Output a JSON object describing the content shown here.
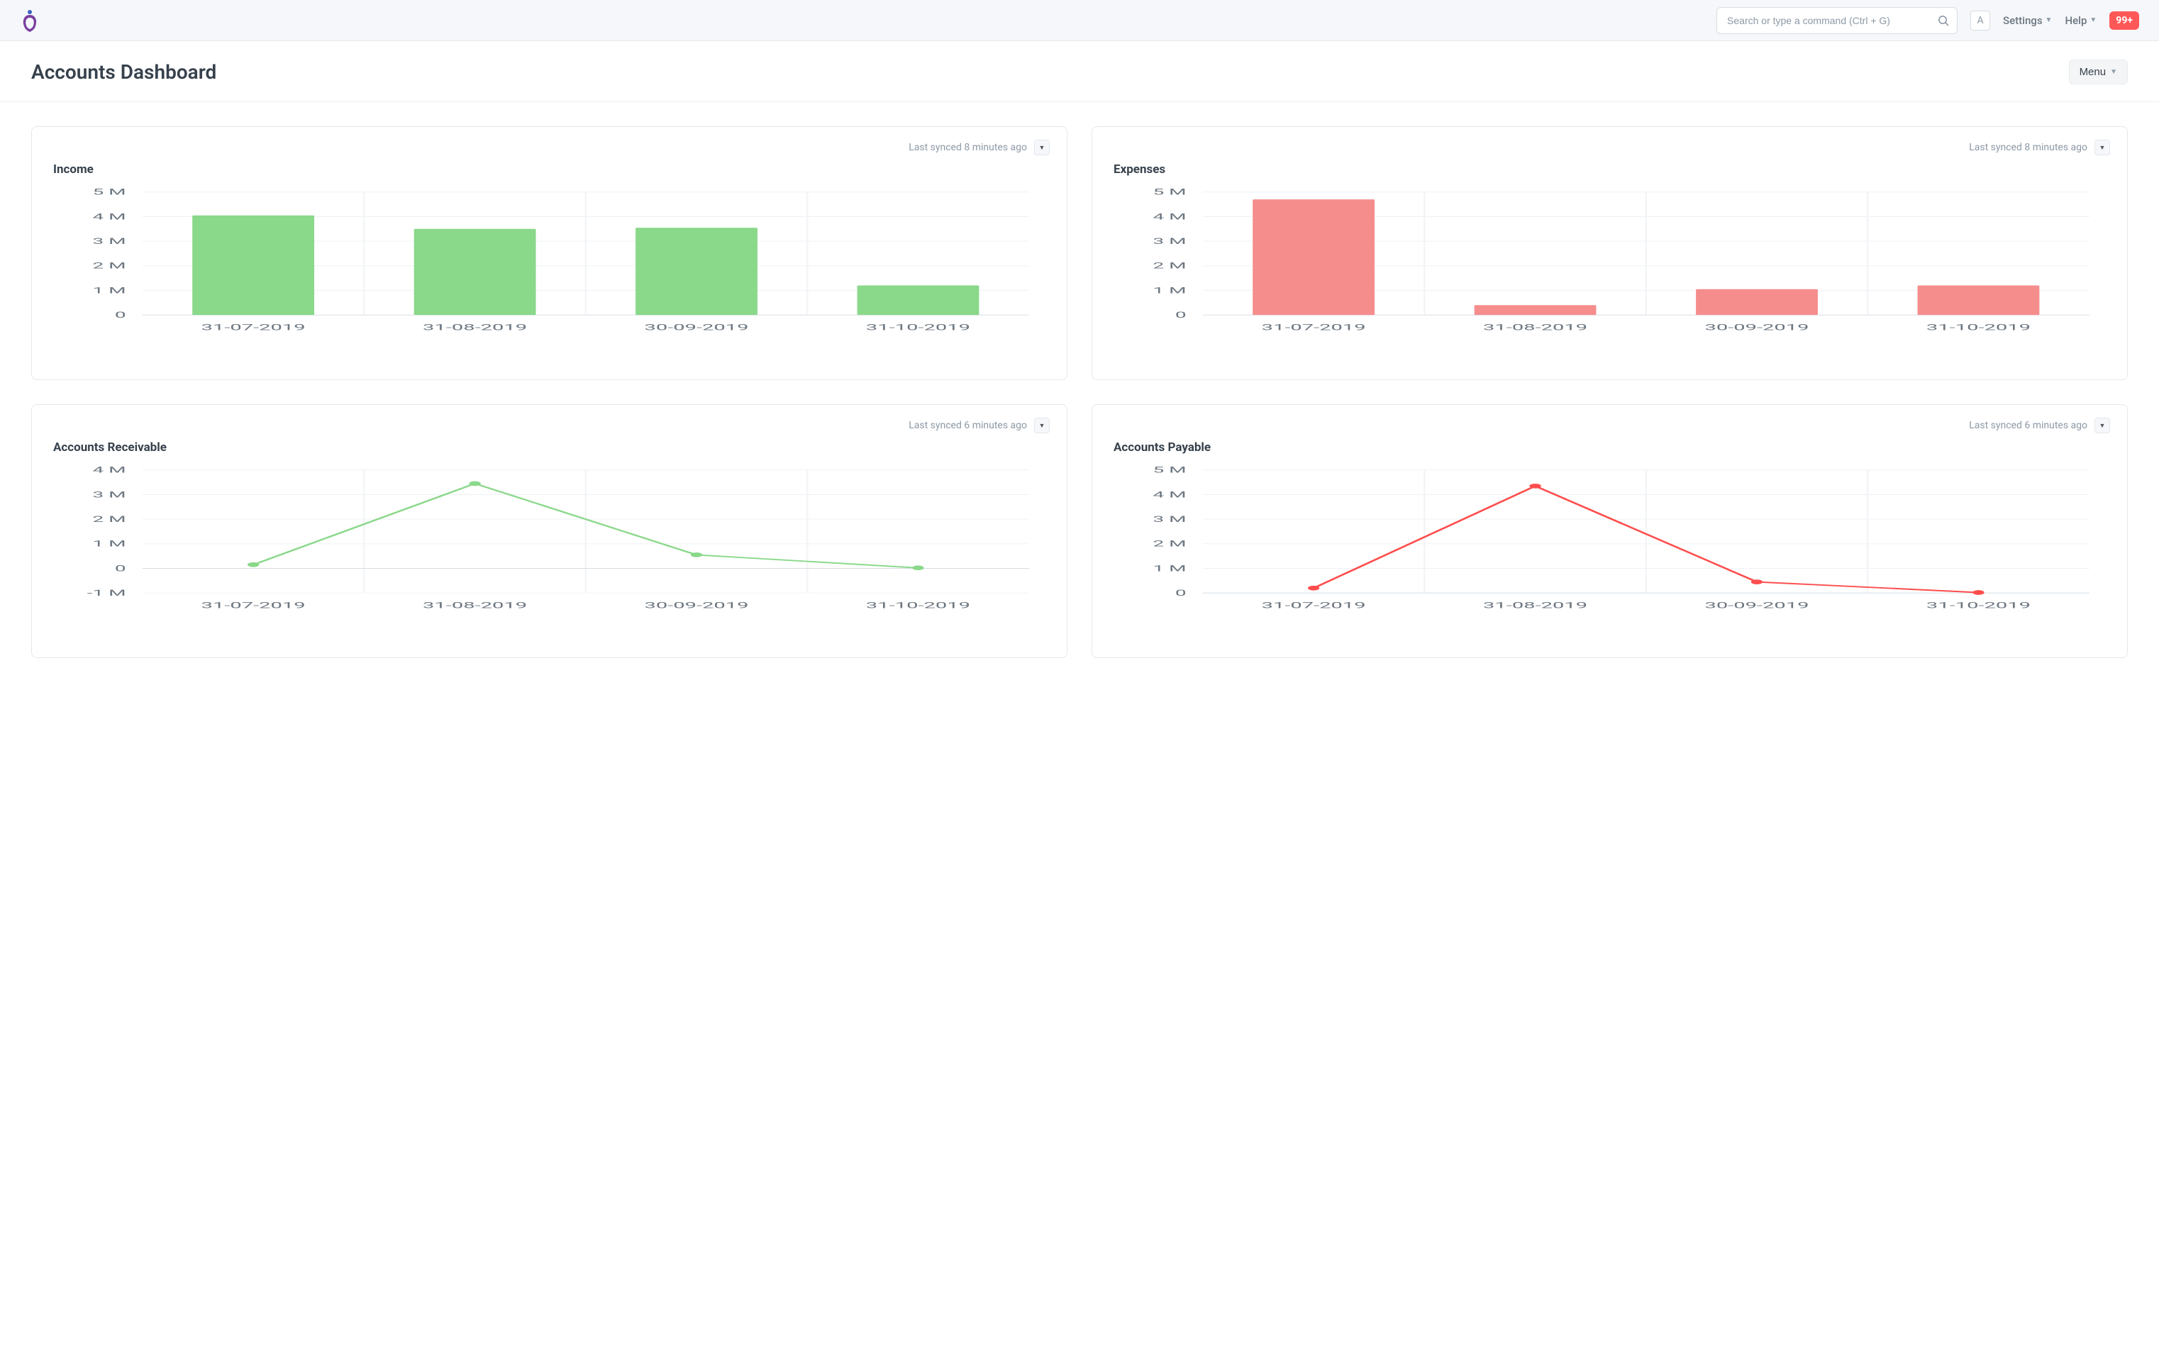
{
  "navbar": {
    "search_placeholder": "Search or type a command (Ctrl + G)",
    "avatar_letter": "A",
    "settings_label": "Settings",
    "help_label": "Help",
    "notif_badge": "99+"
  },
  "page": {
    "title": "Accounts Dashboard",
    "menu_label": "Menu"
  },
  "colors": {
    "green": "#8ad88a",
    "red": "#f58d8d",
    "red_line": "#ff4d4d",
    "grid": "#edf1f5",
    "axis": "#d7dde3",
    "text_muted": "#6c7680"
  },
  "cards": {
    "income": {
      "title": "Income",
      "synced": "Last synced 8 minutes ago"
    },
    "expenses": {
      "title": "Expenses",
      "synced": "Last synced 8 minutes ago"
    },
    "ar": {
      "title": "Accounts Receivable",
      "synced": "Last synced 6 minutes ago"
    },
    "ap": {
      "title": "Accounts Payable",
      "synced": "Last synced 6 minutes ago"
    }
  },
  "chart_data": [
    {
      "id": "income",
      "type": "bar",
      "title": "Income",
      "color": "green",
      "categories": [
        "31-07-2019",
        "31-08-2019",
        "30-09-2019",
        "31-10-2019"
      ],
      "values": [
        4.05,
        3.5,
        3.55,
        1.2
      ],
      "ylabel": "",
      "xlabel": "",
      "ymin": 0,
      "ymax": 5,
      "ystep": 1,
      "y_tick_labels": [
        "0",
        "1 M",
        "2 M",
        "3 M",
        "4 M",
        "5 M"
      ],
      "value_unit": "M"
    },
    {
      "id": "expenses",
      "type": "bar",
      "title": "Expenses",
      "color": "red",
      "categories": [
        "31-07-2019",
        "31-08-2019",
        "30-09-2019",
        "31-10-2019"
      ],
      "values": [
        4.7,
        0.4,
        1.05,
        1.2
      ],
      "ylabel": "",
      "xlabel": "",
      "ymin": 0,
      "ymax": 5,
      "ystep": 1,
      "y_tick_labels": [
        "0",
        "1 M",
        "2 M",
        "3 M",
        "4 M",
        "5 M"
      ],
      "value_unit": "M"
    },
    {
      "id": "ar",
      "type": "line",
      "title": "Accounts Receivable",
      "color": "green",
      "categories": [
        "31-07-2019",
        "31-08-2019",
        "30-09-2019",
        "31-10-2019"
      ],
      "values": [
        0.15,
        3.45,
        0.55,
        0.02
      ],
      "ylabel": "",
      "xlabel": "",
      "ymin": -1,
      "ymax": 4,
      "ystep": 1,
      "y_tick_labels": [
        "-1 M",
        "0",
        "1 M",
        "2 M",
        "3 M",
        "4 M"
      ],
      "value_unit": "M"
    },
    {
      "id": "ap",
      "type": "line",
      "title": "Accounts Payable",
      "color": "red_line",
      "categories": [
        "31-07-2019",
        "31-08-2019",
        "30-09-2019",
        "31-10-2019"
      ],
      "values": [
        0.2,
        4.35,
        0.45,
        0.02
      ],
      "ylabel": "",
      "xlabel": "",
      "ymin": 0,
      "ymax": 5,
      "ystep": 1,
      "y_tick_labels": [
        "0",
        "1 M",
        "2 M",
        "3 M",
        "4 M",
        "5 M"
      ],
      "value_unit": "M"
    }
  ]
}
